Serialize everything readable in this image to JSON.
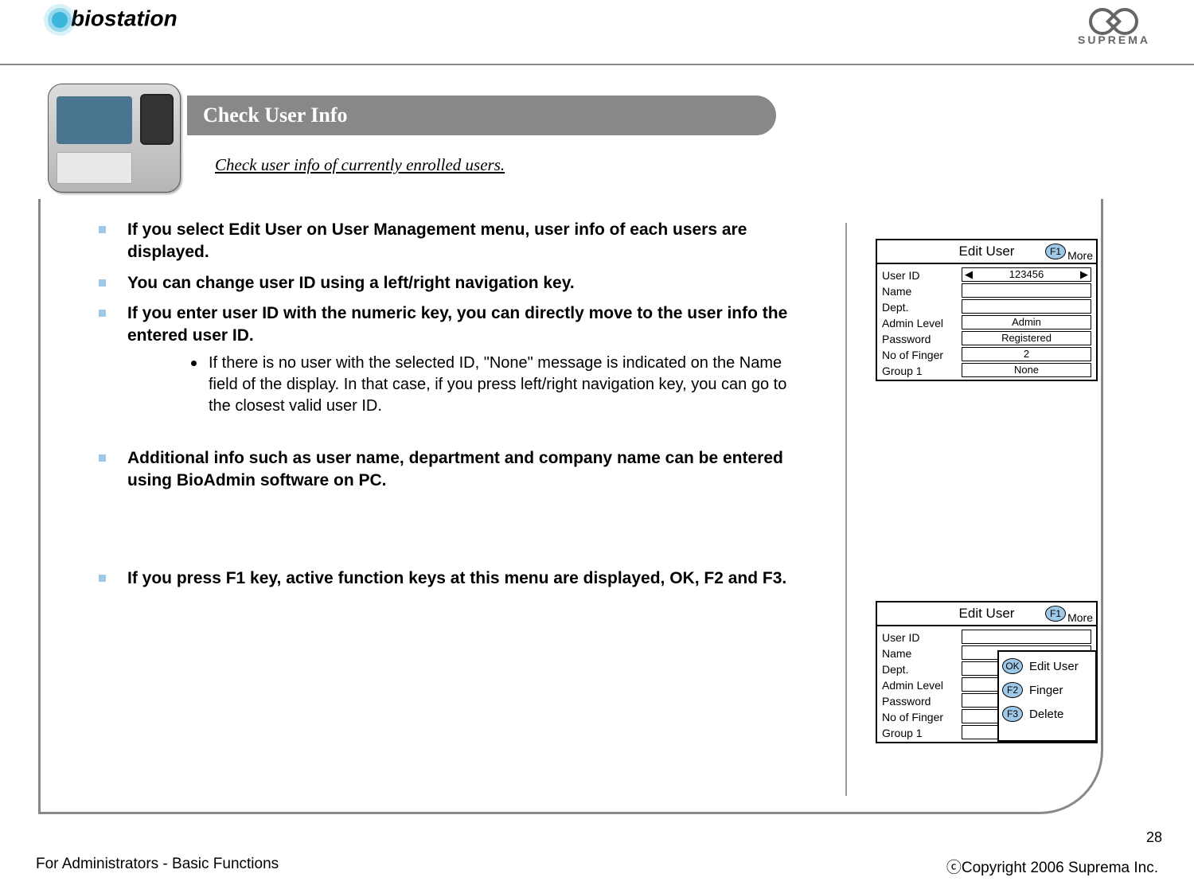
{
  "header": {
    "brand_left": "biostation",
    "brand_right": "SUPREMA"
  },
  "title": "Check User Info",
  "subtitle": "Check user info of currently enrolled users.",
  "bullets": {
    "b1": "If you select Edit User on User Management menu, user info of each users are displayed.",
    "b2": "You can change user ID using a left/right navigation key.",
    "b3": "If you enter user ID with the numeric key, you can directly move to the user info the entered user ID.",
    "b3_sub1": "If there is no user with the selected ID, \"None\" message is indicated on the Name field of the display. In that case, if you press left/right navigation key, you can go to the closest valid user ID.",
    "b4": "Additional info such as user name, department and company name can be entered using BioAdmin software on PC.",
    "b5": "If you press F1 key, active function keys at this menu are displayed, OK, F2 and F3."
  },
  "edit_panel": {
    "title": "Edit User",
    "f1": "F1",
    "more": "More",
    "labels": {
      "user_id": "User ID",
      "name": "Name",
      "dept": "Dept.",
      "admin_level": "Admin Level",
      "password": "Password",
      "no_finger": "No of Finger",
      "group1": "Group 1"
    },
    "values": {
      "user_id": "123456",
      "name": "",
      "dept": "",
      "admin_level": "Admin",
      "password": "Registered",
      "no_finger": "2",
      "group1": "None"
    }
  },
  "popup": {
    "ok": "OK",
    "ok_label": "Edit User",
    "f2": "F2",
    "f2_label": "Finger",
    "f3": "F3",
    "f3_label": "Delete"
  },
  "footer": {
    "left": "For Administrators - Basic Functions",
    "right": "ⓒCopyright 2006 Suprema Inc.",
    "page": "28"
  }
}
